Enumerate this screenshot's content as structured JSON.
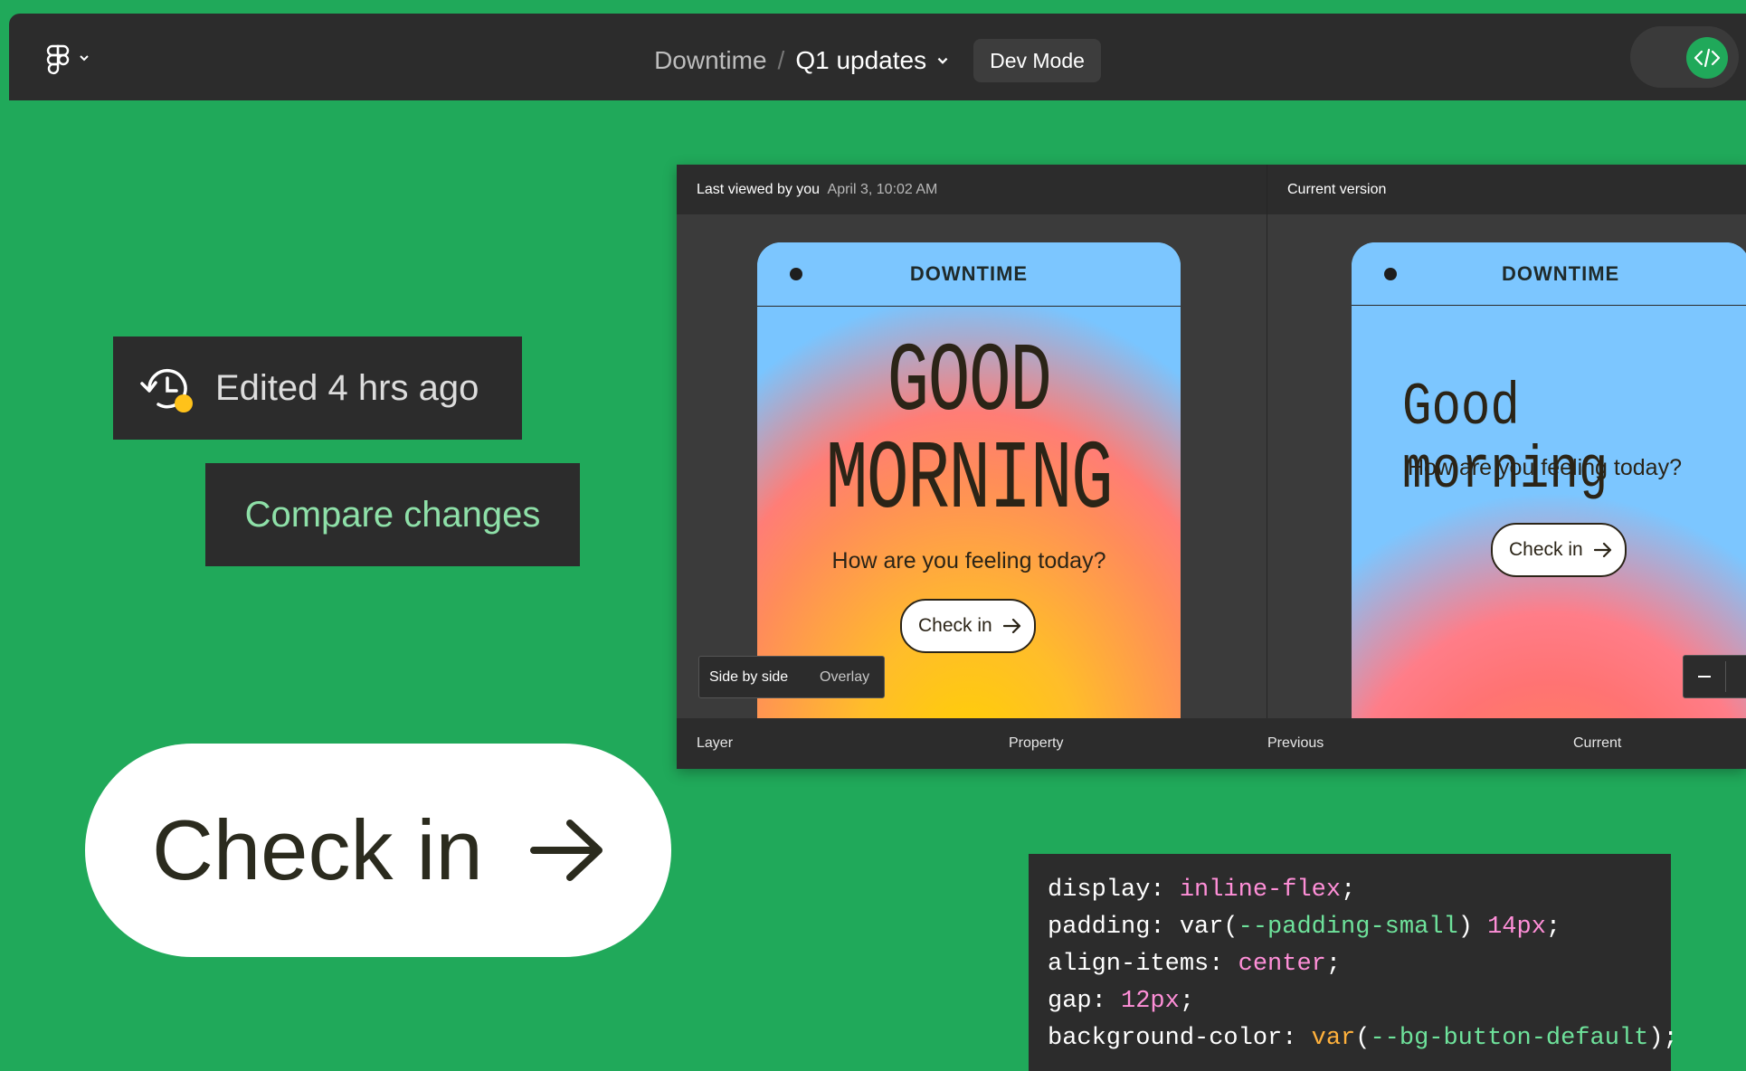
{
  "header": {
    "file": "Downtime",
    "separator": "/",
    "page": "Q1 updates",
    "dev_mode": "Dev Mode"
  },
  "badges": {
    "edited": "Edited 4 hrs ago",
    "compare": "Compare changes"
  },
  "big_button": {
    "label": "Check in"
  },
  "compare_window": {
    "left_title": "Last viewed by you",
    "left_date": "April 3, 10:02 AM",
    "right_title": "Current version",
    "brand": "DOWNTIME",
    "old_heading_line1": "GOOD",
    "old_heading_line2": "MORNING",
    "new_heading": "Good morning",
    "subtitle": "How are you feeling today?",
    "button": "Check in",
    "view_side": "Side by side",
    "view_overlay": "Overlay",
    "columns": [
      "Layer",
      "Property",
      "Previous",
      "Current"
    ]
  },
  "code": {
    "lines": [
      {
        "prop": "display",
        "parts": [
          {
            "t": "inline-flex",
            "c": "pink"
          }
        ]
      },
      {
        "prop": "padding",
        "parts": [
          {
            "t": "var(",
            "c": ""
          },
          {
            "t": "--padding-small",
            "c": "grn"
          },
          {
            "t": ") ",
            "c": ""
          },
          {
            "t": "14px",
            "c": "pink"
          }
        ]
      },
      {
        "prop": "align-items",
        "parts": [
          {
            "t": "center",
            "c": "pink"
          }
        ]
      },
      {
        "prop": "gap",
        "parts": [
          {
            "t": "12px",
            "c": "pink"
          }
        ]
      },
      {
        "prop": "background-color",
        "parts": [
          {
            "t": "var",
            "c": "org"
          },
          {
            "t": "(",
            "c": ""
          },
          {
            "t": "--bg-button-default",
            "c": "grn"
          },
          {
            "t": ")",
            "c": ""
          }
        ]
      }
    ]
  },
  "colors": {
    "background": "#20a95a",
    "panel": "#2c2c2c",
    "accent_green": "#8ee0a8"
  }
}
